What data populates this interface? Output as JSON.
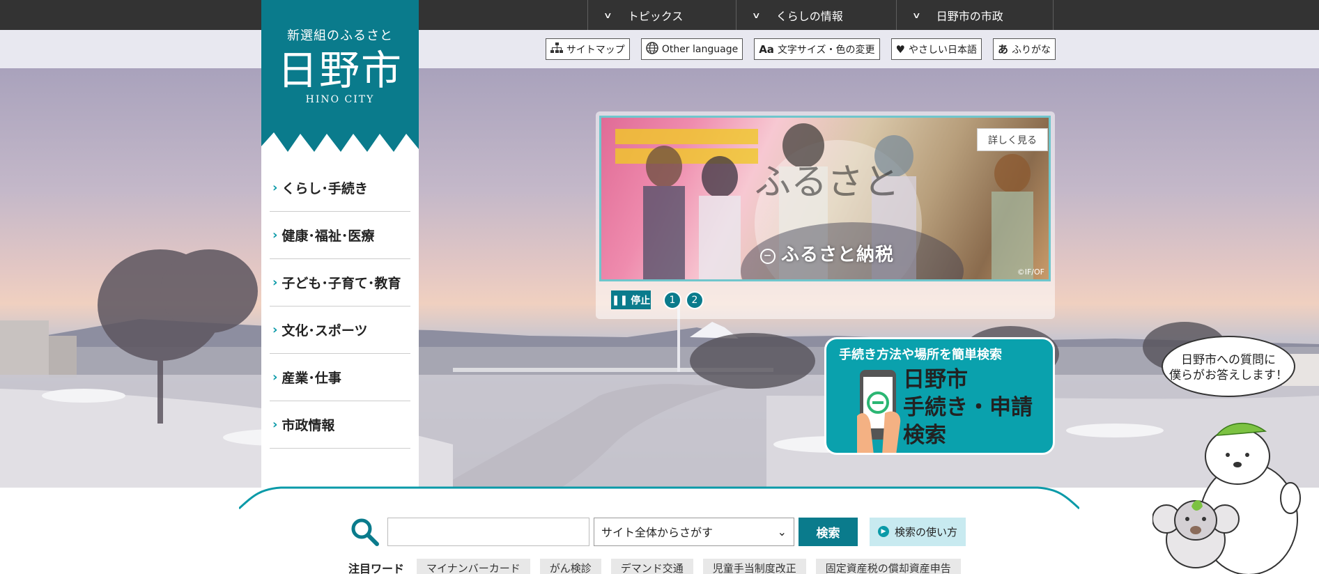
{
  "top_nav": [
    {
      "label": "トピックス"
    },
    {
      "label": "くらしの情報"
    },
    {
      "label": "日野市の市政"
    }
  ],
  "utility": {
    "sitemap": "サイトマップ",
    "other_language": "Other language",
    "text_size": "文字サイズ・色の変更",
    "easy_japanese": "やさしい日本語",
    "furigana": "ふりがな"
  },
  "logo": {
    "tagline": "新選組のふるさと",
    "name": "日野市",
    "english": "HINO CITY"
  },
  "side_menu": [
    {
      "label": "くらし･手続き"
    },
    {
      "label": "健康･福祉･医療"
    },
    {
      "label": "子ども･子育て･教育"
    },
    {
      "label": "文化･スポーツ"
    },
    {
      "label": "産業･仕事"
    },
    {
      "label": "市政情報"
    }
  ],
  "slider": {
    "detail_label": "詳しく見る",
    "caption": "ふるさと納税",
    "stop_label": "停止",
    "dots": [
      "1",
      "2"
    ],
    "credit": "©IF/OF"
  },
  "proc_banner": {
    "top_text": "手続き方法や場所を簡単検索",
    "line1": "日野市",
    "line2": "手続き・申請",
    "line3": "検索"
  },
  "bubble": {
    "line1": "日野市への質問に",
    "line2": "僕らがお答えします！"
  },
  "search": {
    "input_value": "",
    "scope": "サイト全体からさがす",
    "button": "検索",
    "howto": "検索の使い方"
  },
  "keywords": {
    "label": "注目ワード",
    "items": [
      "マイナンバーカード",
      "がん検診",
      "デマンド交通",
      "児童手当制度改正",
      "固定資産税の償却資産申告"
    ]
  },
  "colors": {
    "brand_teal": "#0a7b8c",
    "banner_teal": "#0aa1ad",
    "top_bar": "#333333"
  }
}
